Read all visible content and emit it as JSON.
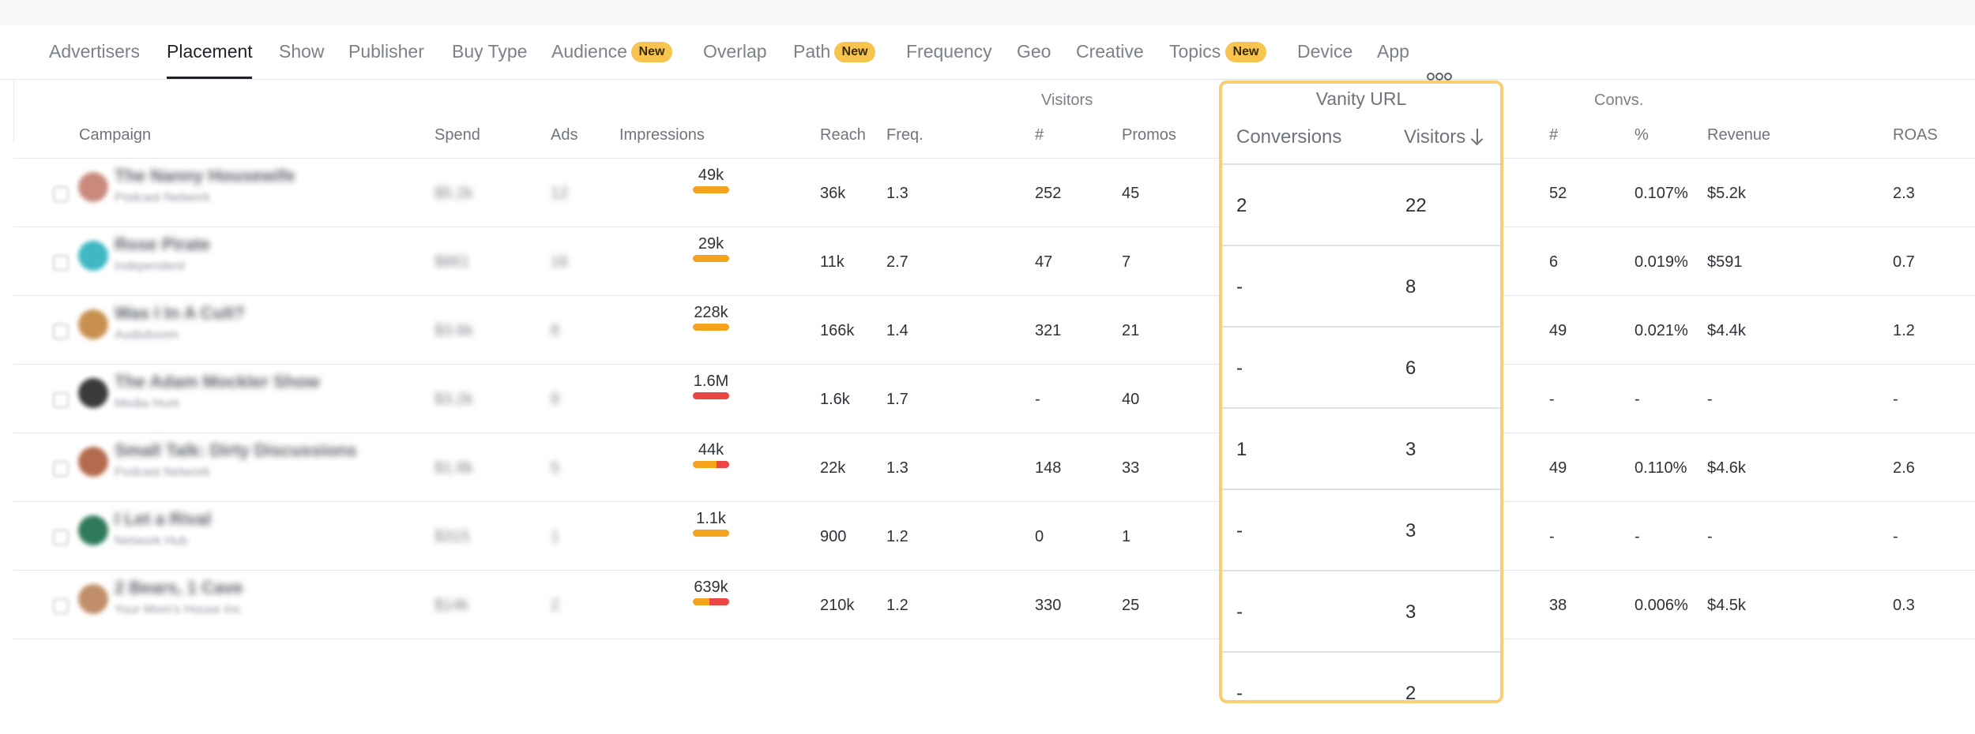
{
  "tabs": [
    {
      "label": "Advertisers"
    },
    {
      "label": "Placement",
      "active": true
    },
    {
      "label": "Show"
    },
    {
      "label": "Publisher"
    },
    {
      "label": "Buy Type"
    },
    {
      "label": "Audience",
      "badge": "New"
    },
    {
      "label": "Overlap"
    },
    {
      "label": "Path",
      "badge": "New"
    },
    {
      "label": "Frequency"
    },
    {
      "label": "Geo"
    },
    {
      "label": "Creative"
    },
    {
      "label": "Topics",
      "badge": "New"
    },
    {
      "label": "Device"
    },
    {
      "label": "App"
    }
  ],
  "groups": {
    "visitors": "Visitors",
    "vanity": "Vanity URL",
    "convs": "Convs."
  },
  "headers": {
    "campaign": "Campaign",
    "spend": "Spend",
    "ads": "Ads",
    "impressions": "Impressions",
    "reach": "Reach",
    "freq": "Freq.",
    "visitors_count": "#",
    "promos": "Promos",
    "vanity_conversions": "Conversions",
    "vanity_visitors": "Visitors",
    "convs_count": "#",
    "convs_pct": "%",
    "revenue": "Revenue",
    "roas": "ROAS"
  },
  "rows": [
    {
      "campaign": "The Nanny Housewife",
      "publisher": "Podcast Network",
      "spend": "$5.2k",
      "ads": "12",
      "impressions": "49k",
      "imp_red_fraction": 0,
      "reach": "36k",
      "freq": "1.3",
      "visitors": "252",
      "promos": "45",
      "conversions": "52",
      "pct": "0.107%",
      "revenue": "$5.2k",
      "roas": "2.3",
      "avatar_color": "#c98a7c"
    },
    {
      "campaign": "Rose Pirate",
      "publisher": "Independent",
      "spend": "$861",
      "ads": "16",
      "impressions": "29k",
      "imp_red_fraction": 0,
      "reach": "11k",
      "freq": "2.7",
      "visitors": "47",
      "promos": "7",
      "conversions": "6",
      "pct": "0.019%",
      "revenue": "$591",
      "roas": "0.7",
      "avatar_color": "#3fb7c4"
    },
    {
      "campaign": "Was I In A Cult?",
      "publisher": "Audioboom",
      "spend": "$3.6k",
      "ads": "8",
      "impressions": "228k",
      "imp_red_fraction": 0,
      "reach": "166k",
      "freq": "1.4",
      "visitors": "321",
      "promos": "21",
      "conversions": "49",
      "pct": "0.021%",
      "revenue": "$4.4k",
      "roas": "1.2",
      "avatar_color": "#c7904f"
    },
    {
      "campaign": "The Adam Mockler Show",
      "publisher": "Media Hunt",
      "spend": "$3.2k",
      "ads": "8",
      "impressions": "1.6M",
      "imp_red_fraction": 1,
      "reach": "1.6k",
      "freq": "1.7",
      "visitors": "-",
      "promos": "40",
      "conversions": "-",
      "pct": "-",
      "revenue": "-",
      "roas": "-",
      "avatar_color": "#3b3b3b"
    },
    {
      "campaign": "Small Talk: Dirty Discussions",
      "publisher": "Podcast Network",
      "spend": "$1.8k",
      "ads": "5",
      "impressions": "44k",
      "imp_red_fraction": 0.35,
      "reach": "22k",
      "freq": "1.3",
      "visitors": "148",
      "promos": "33",
      "conversions": "49",
      "pct": "0.110%",
      "revenue": "$4.6k",
      "roas": "2.6",
      "avatar_color": "#b46a4d"
    },
    {
      "campaign": "I Let a Rival",
      "publisher": "Network Hub",
      "spend": "$315",
      "ads": "1",
      "impressions": "1.1k",
      "imp_red_fraction": 0,
      "reach": "900",
      "freq": "1.2",
      "visitors": "0",
      "promos": "1",
      "conversions": "-",
      "pct": "-",
      "revenue": "-",
      "roas": "-",
      "avatar_color": "#2f7a5a"
    },
    {
      "campaign": "2 Bears, 1 Cave",
      "publisher": "Your Mom's House Inc",
      "spend": "$14k",
      "ads": "2",
      "impressions": "639k",
      "imp_red_fraction": 0.55,
      "reach": "210k",
      "freq": "1.2",
      "visitors": "330",
      "promos": "25",
      "conversions": "38",
      "pct": "0.006%",
      "revenue": "$4.5k",
      "roas": "0.3",
      "avatar_color": "#c08e68"
    }
  ],
  "vanity": [
    {
      "conversions": "2",
      "visitors": "22"
    },
    {
      "conversions": "-",
      "visitors": "8"
    },
    {
      "conversions": "-",
      "visitors": "6"
    },
    {
      "conversions": "1",
      "visitors": "3"
    },
    {
      "conversions": "-",
      "visitors": "3"
    },
    {
      "conversions": "-",
      "visitors": "3"
    },
    {
      "conversions": "-",
      "visitors": "2"
    }
  ],
  "colors": {
    "accent_badge": "#f6c44f",
    "highlight_border": "#f8cd73",
    "bar_orange": "#f4a41c",
    "bar_red": "#ea4646"
  }
}
